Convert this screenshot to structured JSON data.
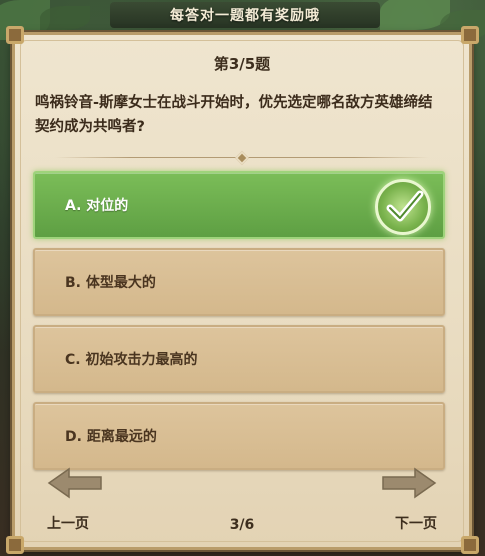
{
  "banner": {
    "title": "每答对一题都有奖励哦"
  },
  "quiz": {
    "counter": "第3/5题",
    "question": "鸣祸铃音-斯摩女士在战斗开始时，优先选定哪名敌方英雄缔结契约成为共鸣者?",
    "options": [
      {
        "label": "A. 对位的",
        "state": "correct"
      },
      {
        "label": "B. 体型最大的",
        "state": "normal"
      },
      {
        "label": "C. 初始攻击力最高的",
        "state": "normal"
      },
      {
        "label": "D. 距离最远的",
        "state": "normal"
      }
    ]
  },
  "footer": {
    "prev_label": "上一页",
    "page_indicator": "3/6",
    "next_label": "下一页"
  },
  "icons": {
    "check": "check-icon",
    "prev_arrow": "arrow-left-icon",
    "next_arrow": "arrow-right-icon"
  },
  "colors": {
    "correct": "#6aac4c",
    "option": "#d8bf95",
    "parchment": "#ece1c8",
    "text": "#3d2e1e"
  }
}
